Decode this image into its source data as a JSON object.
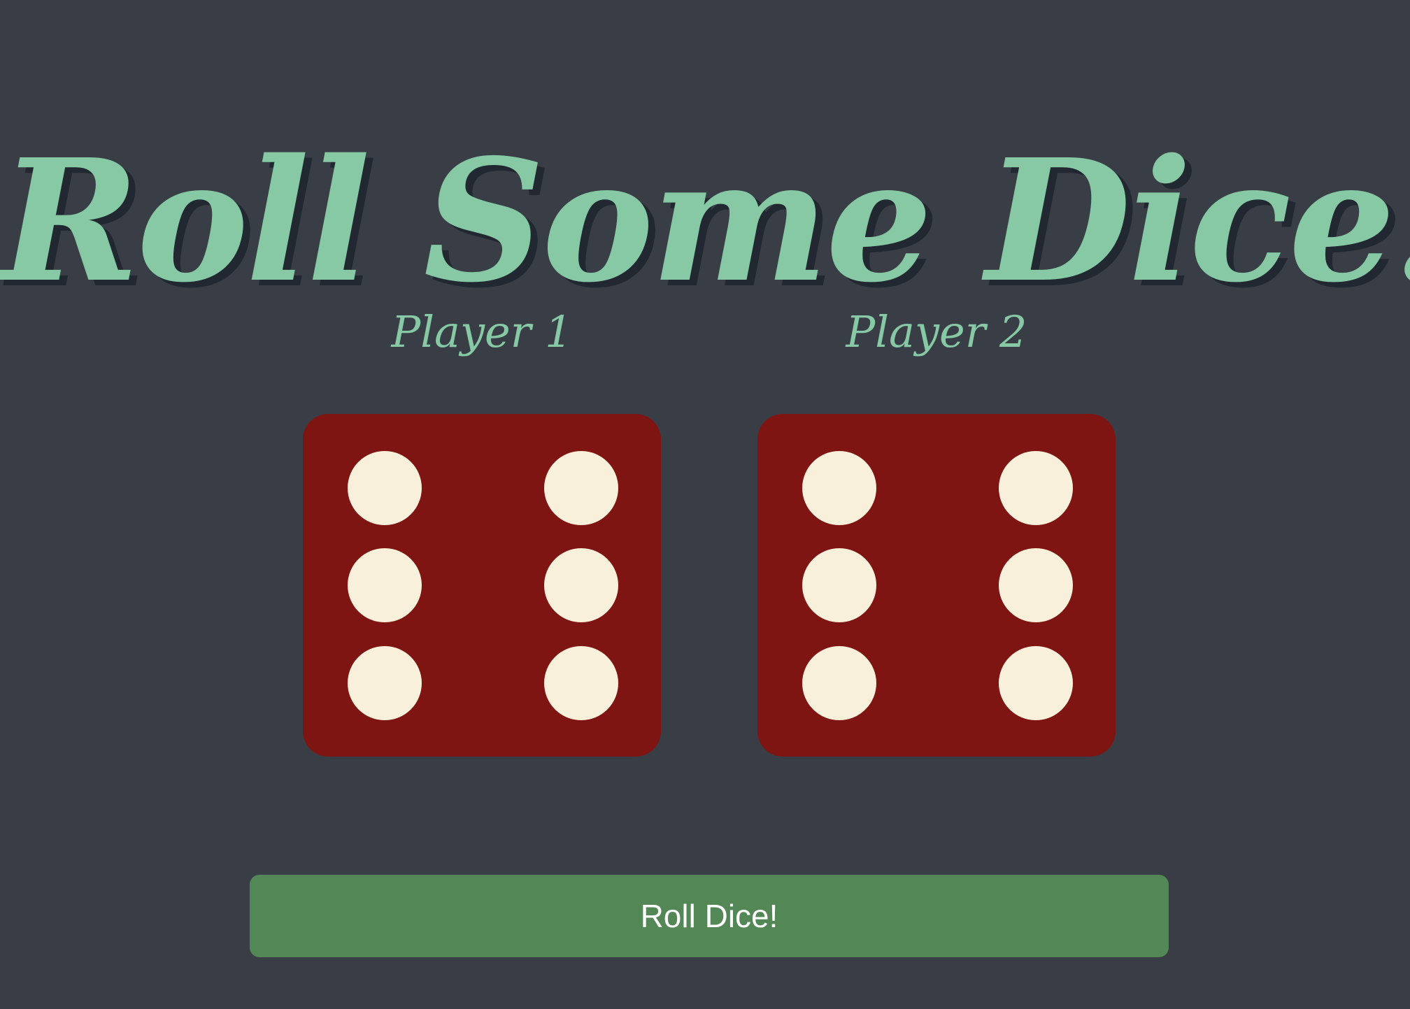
{
  "title": "Roll Some Dice!",
  "players": [
    {
      "label": "Player 1",
      "die_value": 6
    },
    {
      "label": "Player 2",
      "die_value": 6
    }
  ],
  "button": {
    "label": "Roll Dice!"
  },
  "colors": {
    "background": "#393E46",
    "title_accent": "#86C9A4",
    "title_shadow": "#222831",
    "die_face": "#7F1512",
    "pip": "#F8F0DA",
    "button": "#538856",
    "button_text": "#FFFFFF"
  }
}
